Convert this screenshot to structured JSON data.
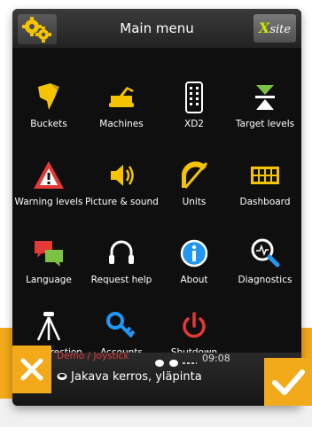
{
  "header": {
    "title": "Main menu",
    "logo_prefix": "X",
    "logo_text": "site",
    "settings_icon": "gear-icon"
  },
  "menu": {
    "buckets": "Buckets",
    "machines": "Machines",
    "xd2": "XD2",
    "target_levels": "Target levels",
    "warning_levels": "Warning levels",
    "picture_sound": "Picture & sound",
    "units": "Units",
    "dashboard": "Dashboard",
    "language": "Language",
    "request_help": "Request help",
    "about": "About",
    "diagnostics": "Diagnostics",
    "rtk_correction": "RTK correction",
    "accounts": "Accounts",
    "shutdown": "Shutdown"
  },
  "footer": {
    "mode": "Demo / Joystick",
    "job": "Jakava kerros, yläpinta",
    "time": "09:08"
  },
  "colors": {
    "accent": "#f2a91a",
    "icon_yellow": "#f5c400",
    "icon_red": "#e53935",
    "icon_blue": "#2196f3",
    "logo_x": "#c8e600"
  }
}
